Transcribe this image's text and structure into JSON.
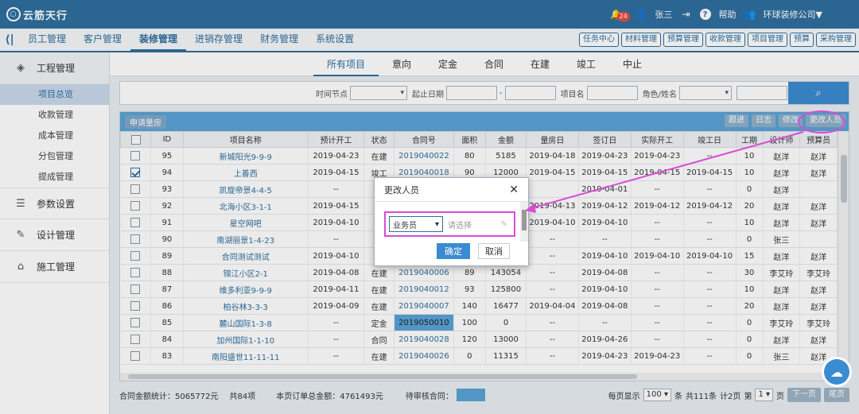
{
  "header": {
    "logo": "云筋天行",
    "notif_count": "24",
    "user": "张三",
    "help": "帮助",
    "company": "环球装修公司▼"
  },
  "nav": {
    "collapse": "⟨|",
    "items": [
      "员工管理",
      "客户管理",
      "装修管理",
      "进销存管理",
      "财务管理",
      "系统设置"
    ],
    "quick": [
      "任务中心",
      "材料管理",
      "预算管理",
      "收款管理",
      "项目管理",
      "预算",
      "采购管理"
    ]
  },
  "sidebar": {
    "groups": [
      {
        "label": "工程管理",
        "items": [
          "项目总览",
          "收款管理",
          "成本管理",
          "分包管理",
          "提成管理"
        ]
      },
      {
        "label": "参数设置"
      },
      {
        "label": "设计管理"
      },
      {
        "label": "施工管理"
      }
    ]
  },
  "tabs": [
    "所有项目",
    "意向",
    "定金",
    "合同",
    "在建",
    "竣工",
    "中止"
  ],
  "filter": {
    "node_label": "时间节点",
    "date_label": "起止日期",
    "dash": "-",
    "project_label": "项目名",
    "role_label": "角色/姓名",
    "search_icon": "search-icon"
  },
  "toolbar": {
    "apply": "申请量房",
    "buttons": [
      "跟进",
      "日志",
      "修改",
      "更改人员"
    ]
  },
  "table": {
    "headers": [
      "",
      "ID",
      "项目名称",
      "预计开工",
      "状态",
      "合同号",
      "面积",
      "金额",
      "量房日",
      "签订日",
      "实际开工",
      "竣工日",
      "工期",
      "设计师",
      "预算员"
    ],
    "rows": [
      [
        "",
        "95",
        "新城阳光9-9-9",
        "2019-04-23",
        "在建",
        "2019040022",
        "80",
        "5185",
        "2019-04-18",
        "2019-04-23",
        "2019-04-23",
        "--",
        "10",
        "赵洋",
        "赵洋"
      ],
      [
        "checked",
        "94",
        "上善西",
        "2019-04-15",
        "竣工",
        "2019040018",
        "90",
        "12000",
        "2019-04-15",
        "2019-04-15",
        "2019-04-15",
        "2019-04-15",
        "10",
        "赵洋",
        "赵洋"
      ],
      [
        "",
        "93",
        "凯旋帝景4-4-5",
        "--",
        "",
        "",
        "",
        "",
        "",
        "2019-04-01",
        "--",
        "--",
        "0",
        "赵洋",
        ""
      ],
      [
        "",
        "92",
        "北海小区3-1-1",
        "2019-04-15",
        "",
        "",
        "",
        "",
        "2019-04-13",
        "2019-04-12",
        "2019-04-12",
        "2019-04-12",
        "20",
        "赵洋",
        "赵洋"
      ],
      [
        "",
        "91",
        "星空网吧",
        "2019-04-10",
        "",
        "",
        "",
        "",
        "2019-04-10",
        "2019-04-10",
        "--",
        "--",
        "10",
        "赵洋",
        "赵洋"
      ],
      [
        "",
        "90",
        "南湖丽景1-4-23",
        "--",
        "",
        "",
        "",
        "",
        "--",
        "--",
        "--",
        "--",
        "0",
        "张三",
        ""
      ],
      [
        "",
        "89",
        "合同测试测试",
        "2019-04-10",
        "",
        "",
        "",
        "",
        "--",
        "2019-04-10",
        "2019-04-10",
        "2019-04-10",
        "15",
        "赵洋",
        "赵洋"
      ],
      [
        "",
        "88",
        "锦江小区2-1",
        "2019-04-08",
        "在建",
        "2019040006",
        "89",
        "143054",
        "--",
        "2019-04-08",
        "--",
        "--",
        "30",
        "李艾玲",
        "李艾玲"
      ],
      [
        "",
        "87",
        "维多利亚9-9-9",
        "2019-04-11",
        "在建",
        "2019040012",
        "93",
        "125800",
        "--",
        "2019-04-10",
        "--",
        "--",
        "10",
        "赵洋",
        "赵洋"
      ],
      [
        "",
        "86",
        "柏谷林3-3-3",
        "2019-04-09",
        "在建",
        "2019040007",
        "140",
        "16477",
        "2019-04-04",
        "2019-04-08",
        "--",
        "--",
        "20",
        "赵洋",
        "赵洋"
      ],
      [
        "",
        "85",
        "麓山国际1-3-8",
        "--",
        "定金",
        "2019050010",
        "100",
        "0",
        "--",
        "--",
        "--",
        "--",
        "0",
        "李艾玲",
        "李艾玲"
      ],
      [
        "",
        "84",
        "加州国际1-1-10",
        "--",
        "合同",
        "2019040028",
        "120",
        "13000",
        "--",
        "2019-04-26",
        "--",
        "--",
        "0",
        "赵洋",
        "赵洋"
      ],
      [
        "",
        "83",
        "南阳盛世11-11-11",
        "--",
        "在建",
        "2019040026",
        "0",
        "11315",
        "--",
        "2019-04-23",
        "2019-04-23",
        "--",
        "0",
        "张三",
        "赵洋"
      ]
    ]
  },
  "footer": {
    "contract_total": "合同金额统计：5065772元",
    "count": "共84项",
    "page_total": "本页订单总金额：4761493元",
    "pending": "待审核合同：",
    "per_page_label": "每页显示",
    "per_page": "100 ▾",
    "bars": "条",
    "total_items": "共111条",
    "total_pages": "计2页",
    "page_prefix": "第",
    "page_no": "1 ▾",
    "page_suffix": "页",
    "next": "下一页",
    "last": "尾页"
  },
  "modal": {
    "title": "更改人员",
    "close": "✕",
    "role_select": "业务员",
    "placeholder": "请选择",
    "ok": "确定",
    "cancel": "取消"
  },
  "accent": "#2f6f9f",
  "highlight": "#d84cd8"
}
